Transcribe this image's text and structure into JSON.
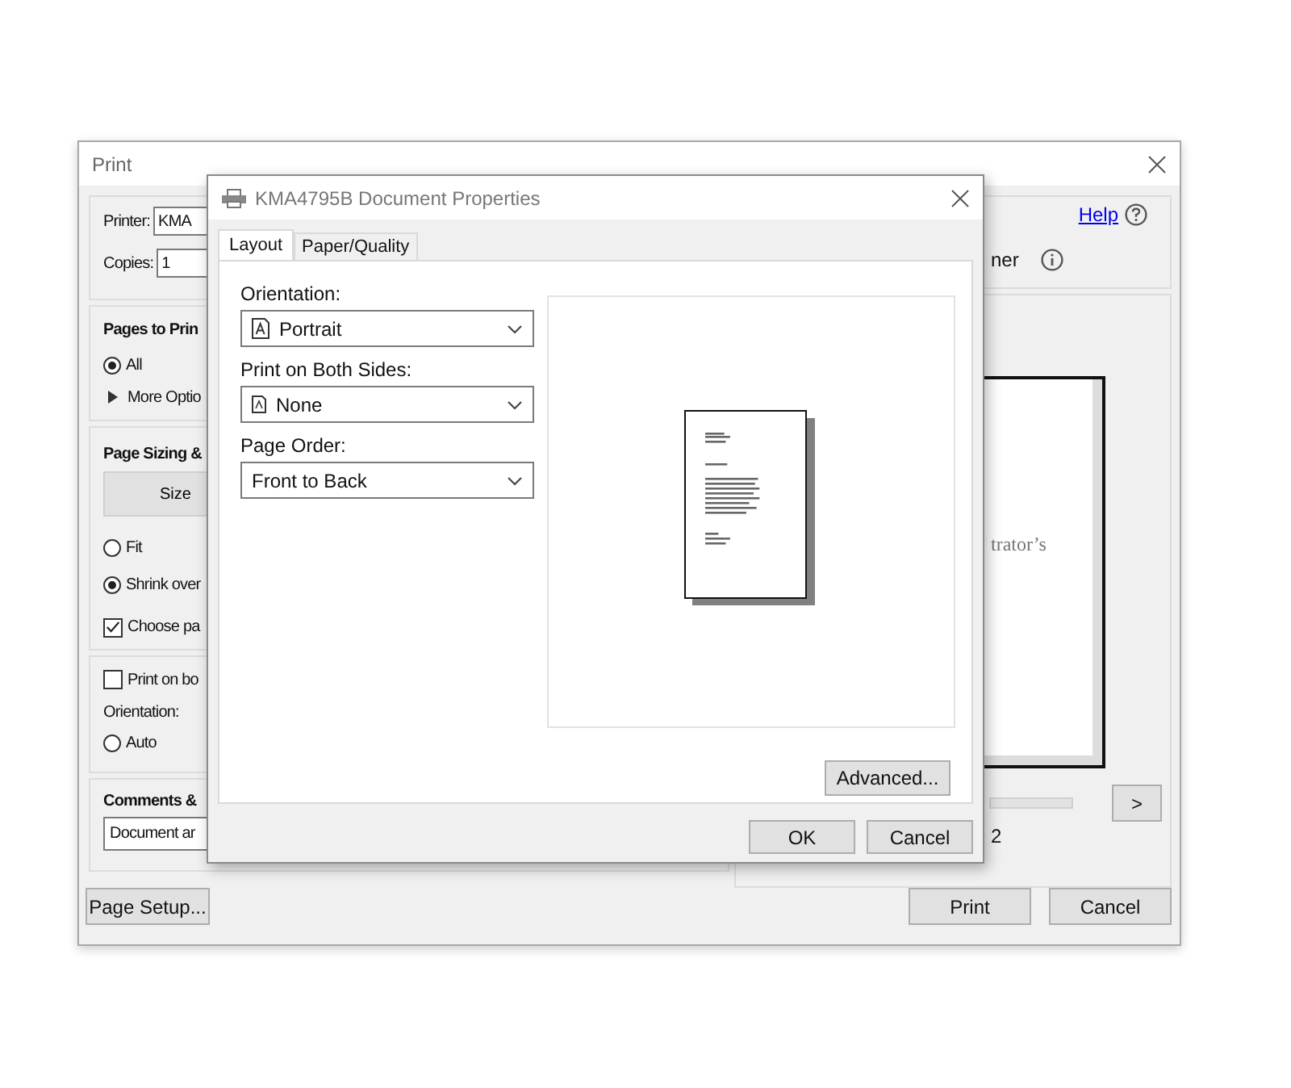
{
  "print_dialog": {
    "title": "Print",
    "printer": {
      "label": "Printer:",
      "value": "KMA"
    },
    "copies": {
      "label": "Copies:",
      "value": "1"
    },
    "help_link": "Help",
    "printer_option_text": "ner",
    "pages_to_print": {
      "heading": "Pages to Prin",
      "options": [
        {
          "label": "All",
          "selected": true
        }
      ],
      "more_options": "More Optio"
    },
    "page_sizing": {
      "heading": "Page Sizing &",
      "size_button": "Size",
      "options": [
        {
          "label": "Fit",
          "selected": false
        },
        {
          "label": "Shrink over",
          "selected": true
        }
      ],
      "choose_paper": {
        "label": "Choose pa",
        "checked": true
      }
    },
    "print_both_sides": {
      "label": "Print on bo",
      "checked": false
    },
    "orientation": {
      "label": "Orientation:",
      "options": [
        {
          "label": "Auto",
          "selected": false
        }
      ]
    },
    "comments": {
      "heading": "Comments &",
      "value": "Document ar"
    },
    "preview": {
      "text": "trator’s",
      "next_button": ">",
      "page_info": "2"
    },
    "page_setup_button": "Page Setup...",
    "buttons": [
      "Print",
      "Cancel"
    ]
  },
  "properties_dialog": {
    "title": "KMA4795B Document Properties",
    "tabs": [
      {
        "label": "Layout",
        "selected": true
      },
      {
        "label": "Paper/Quality",
        "selected": false
      }
    ],
    "settings": [
      {
        "label": "Orientation:",
        "value": "Portrait",
        "kind": "portrait"
      },
      {
        "label": "Print on Both Sides:",
        "value": "None",
        "kind": "duplex"
      },
      {
        "label": "Page Order:",
        "value": "Front to Back",
        "kind": "plain"
      }
    ],
    "advanced_button": "Advanced...",
    "buttons": [
      "OK",
      "Cancel"
    ]
  }
}
